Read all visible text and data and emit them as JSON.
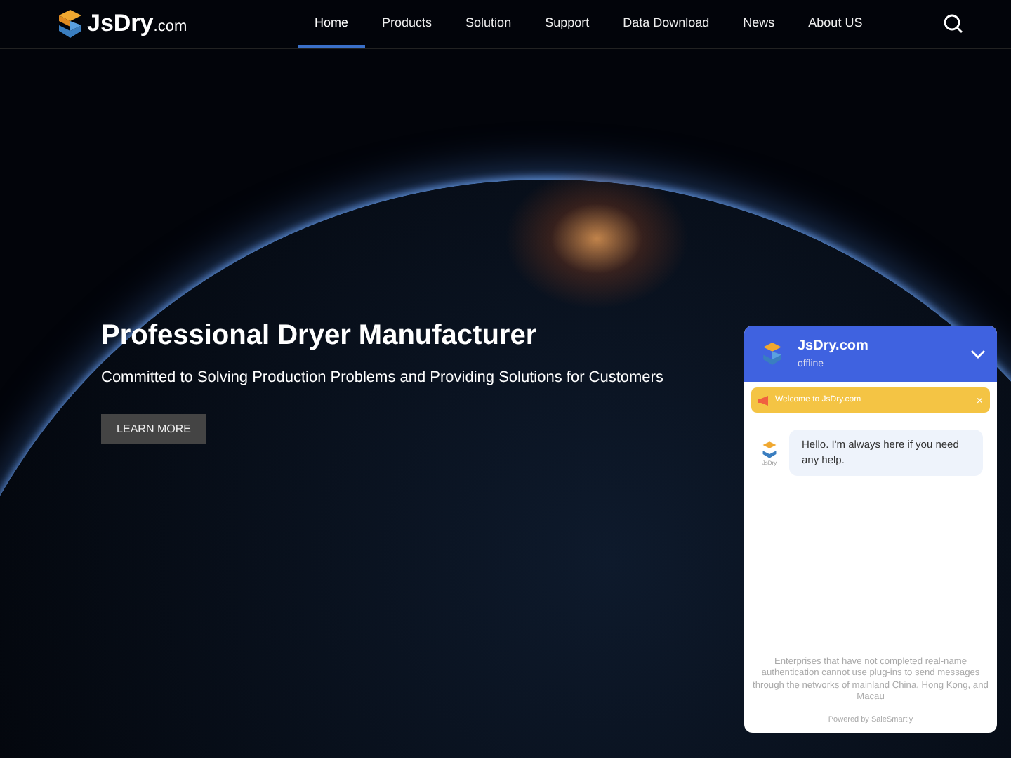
{
  "header": {
    "logo": {
      "name": "JsDry",
      "suffix": ".com"
    },
    "nav": [
      {
        "label": "Home",
        "selected": true
      },
      {
        "label": "Products",
        "selected": false
      },
      {
        "label": "Solution",
        "selected": false
      },
      {
        "label": "Support",
        "selected": false
      },
      {
        "label": "Data Download",
        "selected": false
      },
      {
        "label": "News",
        "selected": false
      },
      {
        "label": "About US",
        "selected": false
      }
    ]
  },
  "hero": {
    "title": "Professional Dryer Manufacturer",
    "subtitle": "Committed to Solving Production Problems and Providing Solutions for Customers",
    "button": "LEARN MORE"
  },
  "chat": {
    "name": "JsDry.com",
    "status": "offline",
    "banner": "Welcome to JsDry.com",
    "banner_close": "×",
    "avatar_caption": "JsDry",
    "message": "Hello. I'm always here if you need any help.",
    "notice": "Enterprises that have not completed real-name authentication cannot use plug-ins to send messages through the networks of mainland China, Hong Kong, and Macau",
    "powered": "Powered by SaleSmartly"
  }
}
